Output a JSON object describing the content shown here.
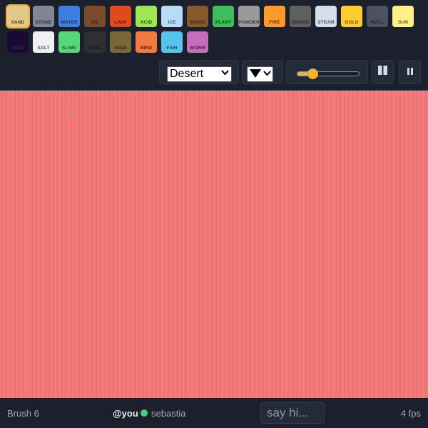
{
  "palette": {
    "selected": "SAND",
    "elements": [
      {
        "label": "SAND",
        "color": "#e2c98b",
        "text_color": "#4a3f22"
      },
      {
        "label": "STONE",
        "color": "#808693",
        "text_color": "#2e3340"
      },
      {
        "label": "WATER",
        "color": "#3f7fe0",
        "text_color": "#1f3557"
      },
      {
        "label": "OIL",
        "color": "#7a4a2c",
        "text_color": "#3a2210"
      },
      {
        "label": "LAVA",
        "color": "#e04a1c",
        "text_color": "#5a1a05"
      },
      {
        "label": "ACID",
        "color": "#9ee652",
        "text_color": "#2f4e12"
      },
      {
        "label": "ICE",
        "color": "#b7dcf8",
        "text_color": "#3c5b75"
      },
      {
        "label": "WOOD",
        "color": "#85592c",
        "text_color": "#3c260e"
      },
      {
        "label": "PLANT",
        "color": "#3fbd5a",
        "text_color": "#134a1f"
      },
      {
        "label": "POWDER",
        "color": "#9a9a9a",
        "text_color": "#3c3c3c"
      },
      {
        "label": "FIRE",
        "color": "#ff9b2a",
        "text_color": "#6a3408"
      },
      {
        "label": "SMOKE",
        "color": "#5f5f5f",
        "text_color": "#2a2a2a"
      },
      {
        "label": "STEAM",
        "color": "#d6dfe8",
        "text_color": "#4e5866"
      },
      {
        "label": "GOLD",
        "color": "#ffcc2e",
        "text_color": "#6a4e06"
      },
      {
        "label": "WALL",
        "color": "#4a5263",
        "text_color": "#20252f"
      },
      {
        "label": "SUN",
        "color": "#fff08a",
        "text_color": "#6b5b14"
      },
      {
        "label": "VOID",
        "color": "#1a0a33",
        "text_color": "#3a2a55"
      },
      {
        "label": "SALT",
        "color": "#f0f0f4",
        "text_color": "#555a66"
      },
      {
        "label": "SLIME",
        "color": "#58d67a",
        "text_color": "#1a5a2b"
      },
      {
        "label": "COAL",
        "color": "#2d2f33",
        "text_color": "#161719"
      },
      {
        "label": "SEED",
        "color": "#7a6636",
        "text_color": "#33290f"
      },
      {
        "label": "BIRD",
        "color": "#f07a40",
        "text_color": "#5a2a0d"
      },
      {
        "label": "FISH",
        "color": "#56c5ee",
        "text_color": "#1b4e61"
      },
      {
        "label": "WORM",
        "color": "#c46fb7",
        "text_color": "#4e1f47"
      }
    ]
  },
  "controls": {
    "scene": "Desert",
    "brush_shape_icon": "down-triangle-icon",
    "brush_size_fraction": 0.18,
    "slider_color": "#f7b02b",
    "columns_icon": "columns-icon",
    "pause_icon": "pause-icon"
  },
  "canvas": {
    "background": "#f27878"
  },
  "footer": {
    "brush_label": "Brush 6",
    "me_label": "@you",
    "peer_name": "sebastia",
    "peer_status_color": "#3ed47c",
    "chat_placeholder": "say hi...",
    "fps_label": "4 fps"
  }
}
